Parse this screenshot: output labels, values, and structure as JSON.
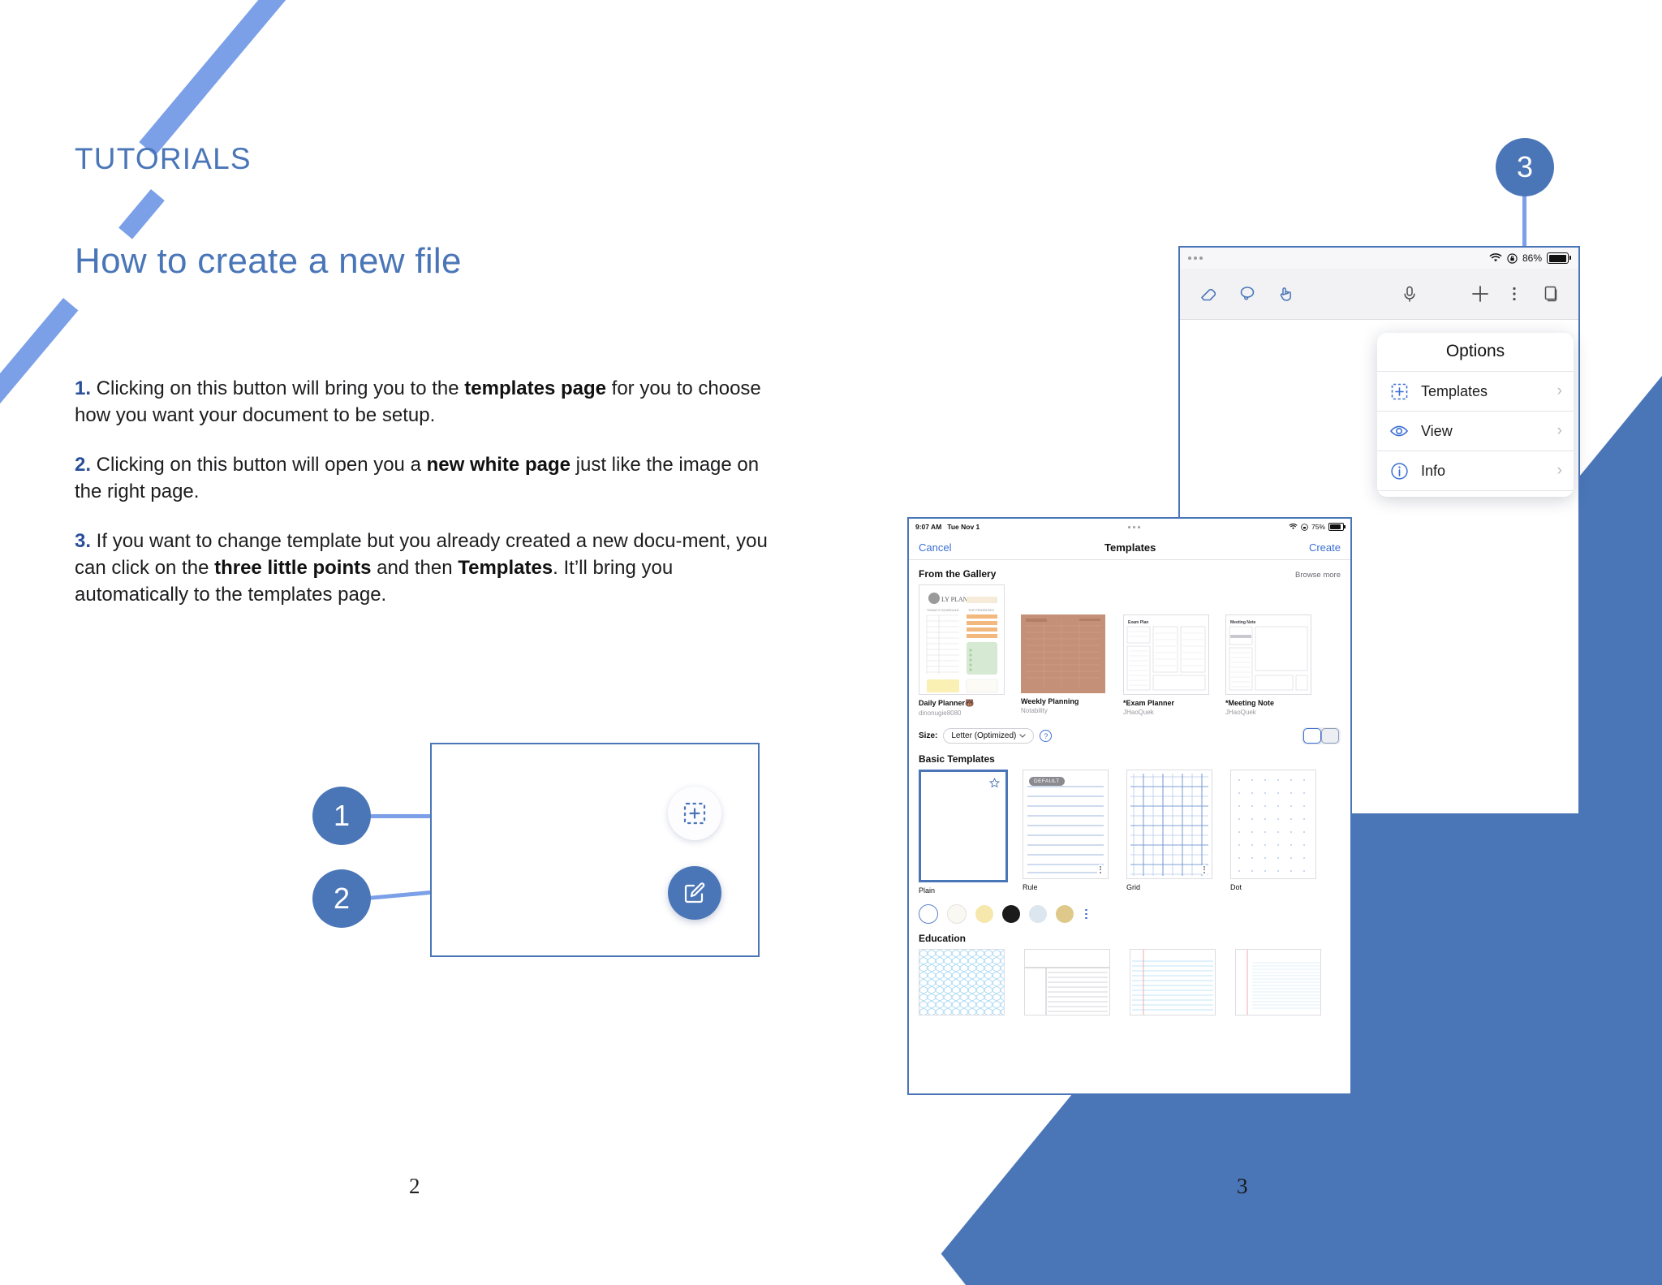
{
  "document": {
    "eyebrow": "TUTORIALS",
    "headline": "How to create a new file",
    "page_number_left": "2",
    "page_number_right": "3",
    "accent_color": "#4a76b8",
    "accent_light": "#7ba0e8"
  },
  "instructions": [
    {
      "num": "1.",
      "parts": [
        {
          "t": " Clicking on this button will bring you to the ",
          "b": false
        },
        {
          "t": "templates page",
          "b": true
        },
        {
          "t": " for you to choose how you want your document to be setup.",
          "b": false
        }
      ]
    },
    {
      "num": "2.",
      "parts": [
        {
          "t": " Clicking on this button will open you a ",
          "b": false
        },
        {
          "t": "new white page",
          "b": true
        },
        {
          "t": " just like the image on the right page.",
          "b": false
        }
      ]
    },
    {
      "num": "3.",
      "parts": [
        {
          "t": " If you want to change template but you already created a new docu‑ment, you can click on the ",
          "b": false
        },
        {
          "t": "three little points",
          "b": true
        },
        {
          "t": " and then ",
          "b": false
        },
        {
          "t": "Templates",
          "b": true
        },
        {
          "t": ". It’ll bring you automatically to the templates page.",
          "b": false
        }
      ]
    }
  ],
  "callout_diagram": {
    "bullets": [
      {
        "label": "1",
        "target": "new-from-template-fab"
      },
      {
        "label": "2",
        "target": "new-note-fab"
      }
    ],
    "fab_template_icon": "dashed-square-plus-icon",
    "fab_new_icon": "compose-pencil-icon"
  },
  "badge_three": "3",
  "note_editor": {
    "status_bar": {
      "battery_percent": "86%",
      "wifi_icon": "wifi-icon",
      "lock_icon": "rotation-lock-icon"
    },
    "toolbar_tools": [
      {
        "name": "eraser-icon"
      },
      {
        "name": "lasso-icon"
      },
      {
        "name": "hand-pointer-icon"
      },
      {
        "name": "microphone-icon"
      },
      {
        "name": "plus-icon"
      },
      {
        "name": "more-vertical-icon"
      },
      {
        "name": "pages-icon"
      }
    ]
  },
  "options_popup": {
    "title": "Options",
    "items": [
      {
        "label": "Templates",
        "icon": "dashed-square-plus-icon",
        "chevron": "›"
      },
      {
        "label": "View",
        "icon": "eye-icon",
        "chevron": "›"
      },
      {
        "label": "Info",
        "icon": "info-circle-icon",
        "chevron": "›"
      }
    ]
  },
  "templates_screen": {
    "status_bar": {
      "time": "9:07 AM",
      "date": "Tue Nov 1",
      "battery_percent": "75%"
    },
    "nav": {
      "cancel": "Cancel",
      "title": "Templates",
      "create": "Create"
    },
    "gallery": {
      "heading": "From the Gallery",
      "browse_more": "Browse more",
      "items": [
        {
          "name": "Daily Planner🐻",
          "author": "dinonugie8080"
        },
        {
          "name": "Weekly Planning",
          "author": "Notability"
        },
        {
          "name": "*Exam Planner",
          "author": "JHaoQuek"
        },
        {
          "name": "*Meeting Note",
          "author": "JHaoQuek"
        }
      ]
    },
    "size_row": {
      "label": "Size:",
      "value": "Letter (Optimized)",
      "help_icon": "question-circle-icon",
      "orientation": [
        {
          "name": "portrait-icon",
          "selected": true
        },
        {
          "name": "landscape-icon",
          "selected": false
        }
      ]
    },
    "basic": {
      "heading": "Basic Templates",
      "items": [
        {
          "name": "Plain",
          "selected": true,
          "badge": "",
          "star": true
        },
        {
          "name": "Rule",
          "selected": false,
          "badge": "DEFAULT",
          "star": false
        },
        {
          "name": "Grid",
          "selected": false,
          "badge": "",
          "star": false
        },
        {
          "name": "Dot",
          "selected": false,
          "badge": "",
          "star": false
        }
      ],
      "paper_colors": [
        "#ffffff",
        "#faf8f2",
        "#f6e7ac",
        "#1b1b1b",
        "#dbe6ef",
        "#dfc98a"
      ],
      "more_colors_icon": "more-vertical-icon"
    },
    "education": {
      "heading": "Education",
      "items": [
        {
          "name": "hexagon-paper"
        },
        {
          "name": "cornell-notes-paper"
        },
        {
          "name": "ruled-red-margin-paper"
        },
        {
          "name": "narrow-ruled-paper"
        }
      ]
    }
  }
}
